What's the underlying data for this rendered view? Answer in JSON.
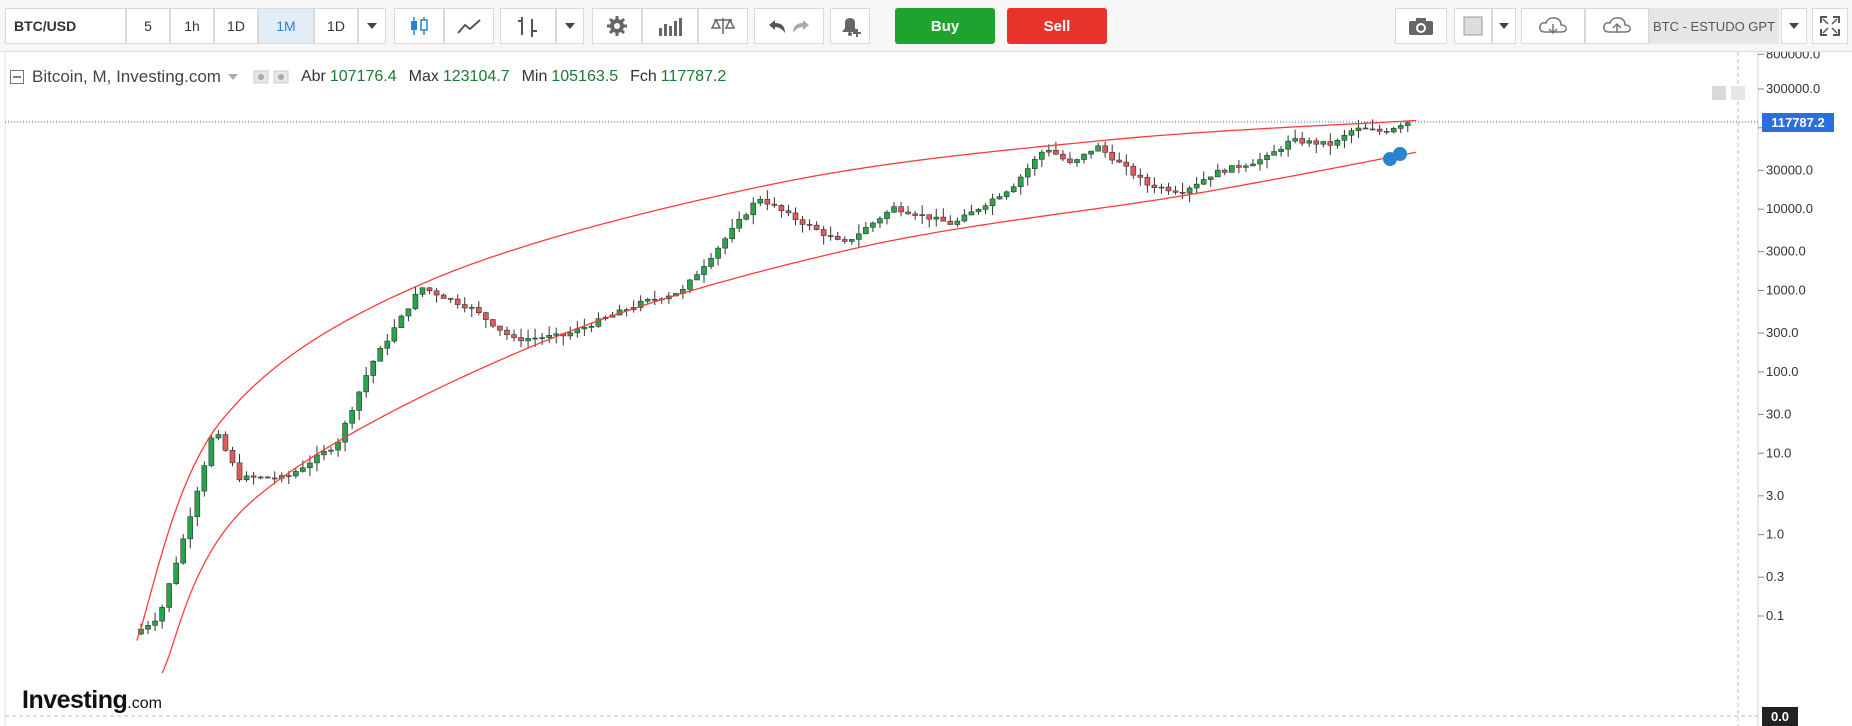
{
  "toolbar": {
    "symbol": "BTC/USD",
    "timeframes": [
      "5",
      "1h",
      "1D",
      "1M",
      "1D"
    ],
    "active_timeframe": "1M",
    "buy_label": "Buy",
    "sell_label": "Sell",
    "template_label": "BTC - ESTUDO GPT",
    "icons": [
      "candles-icon",
      "line-chart-icon",
      "indicator-icon",
      "dropdown-icon",
      "gear-icon",
      "bars-icon",
      "scales-icon",
      "undo-icon",
      "redo-icon",
      "alert-bell-icon",
      "camera-icon",
      "color-box-icon",
      "cloud-download-icon",
      "cloud-upload-icon",
      "fullscreen-icon"
    ]
  },
  "legend": {
    "title": "Bitcoin, M, Investing.com",
    "open_label": "Abr",
    "open": "107176.4",
    "high_label": "Max",
    "high": "123104.7",
    "low_label": "Min",
    "low": "105163.5",
    "close_label": "Fch",
    "close": "117787.2"
  },
  "brand": {
    "name": "Investing",
    "suffix": ".com"
  },
  "price_tag": "117787.2",
  "zero_tag": "0.0",
  "colors": {
    "up": "#26a54a",
    "down": "#e05a5a",
    "channel": "#ff3b3b",
    "price_line": "#2a6fdb"
  },
  "chart_data": {
    "type": "candlestick",
    "scale": "log",
    "y_ticks": [
      "800000.0",
      "300000.0",
      "100000.0",
      "30000.0",
      "10000.0",
      "3000.0",
      "1000.0",
      "300.0",
      "100.0",
      "30.0",
      "10.0",
      "3.0",
      "1.0",
      "0.3",
      "0.1"
    ],
    "y_tick_values": [
      800000,
      300000,
      100000,
      30000,
      10000,
      3000,
      1000,
      300,
      100,
      30,
      10,
      3,
      1,
      0.3,
      0.1
    ],
    "last_price": 117787.2,
    "anchors": [
      [
        2010.5,
        0.06
      ],
      [
        2010.8,
        0.1
      ],
      [
        2011.1,
        1.0
      ],
      [
        2011.45,
        20
      ],
      [
        2011.75,
        5
      ],
      [
        2012.3,
        5
      ],
      [
        2012.9,
        13
      ],
      [
        2013.3,
        120
      ],
      [
        2013.9,
        1100
      ],
      [
        2014.5,
        600
      ],
      [
        2015.0,
        250
      ],
      [
        2015.6,
        280
      ],
      [
        2016.5,
        700
      ],
      [
        2017.0,
        1000
      ],
      [
        2017.9,
        14000
      ],
      [
        2018.2,
        9000
      ],
      [
        2018.9,
        3700
      ],
      [
        2019.5,
        10500
      ],
      [
        2020.2,
        6500
      ],
      [
        2020.9,
        19000
      ],
      [
        2021.3,
        58000
      ],
      [
        2021.6,
        35000
      ],
      [
        2021.9,
        60000
      ],
      [
        2022.5,
        20000
      ],
      [
        2022.9,
        16500
      ],
      [
        2023.3,
        28000
      ],
      [
        2023.9,
        42000
      ],
      [
        2024.2,
        70000
      ],
      [
        2024.7,
        62000
      ],
      [
        2024.95,
        97000
      ],
      [
        2025.3,
        90000
      ],
      [
        2025.55,
        117787
      ]
    ],
    "channel_upper": [
      [
        2010.45,
        0.05
      ],
      [
        2011.45,
        25
      ],
      [
        2013.9,
        1300
      ],
      [
        2017.95,
        20000
      ],
      [
        2021.9,
        70000
      ],
      [
        2025.6,
        123000
      ]
    ],
    "channel_lower": [
      [
        2010.75,
        0.02
      ],
      [
        2011.8,
        2.5
      ],
      [
        2015.1,
        200
      ],
      [
        2018.9,
        3200
      ],
      [
        2022.9,
        15000
      ],
      [
        2025.6,
        50000
      ]
    ]
  }
}
